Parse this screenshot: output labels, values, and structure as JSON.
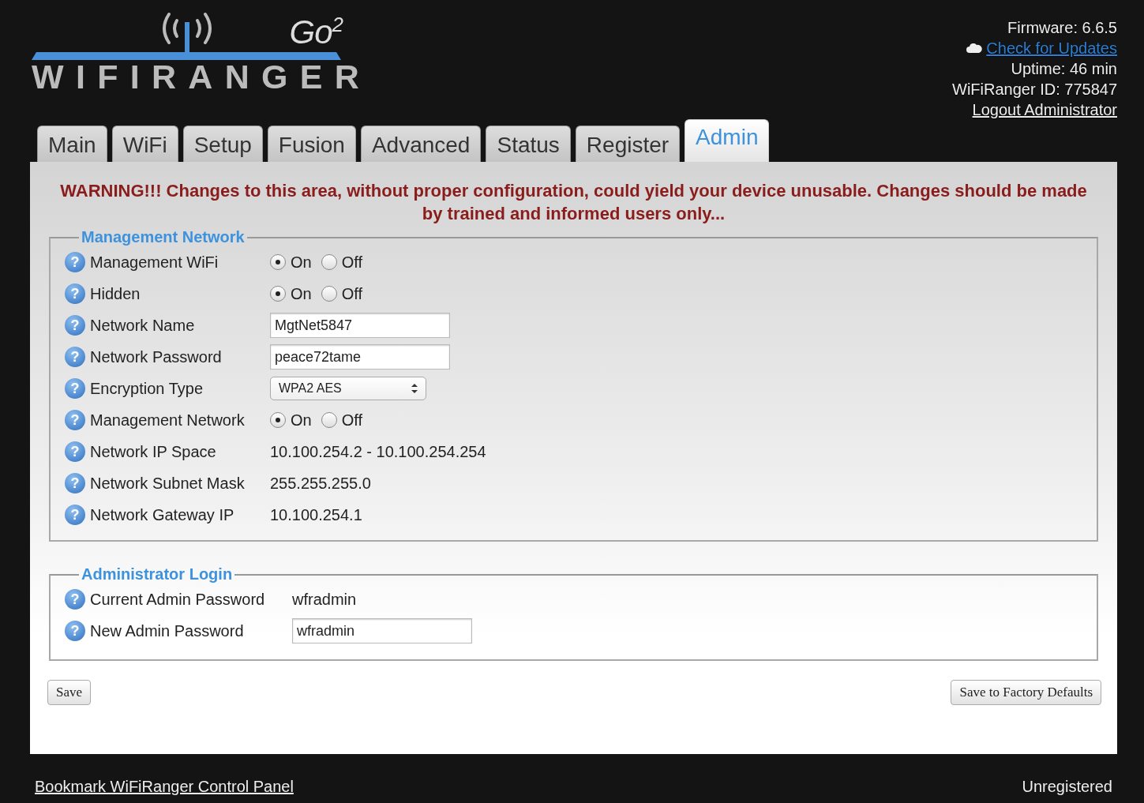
{
  "logo": {
    "edition": "Go$^{2}$",
    "wordmark": "WIFIRANGER"
  },
  "status": [
    {
      "kind": "text",
      "text": "Firmware: 6.6.5"
    },
    {
      "kind": "link",
      "text": "Check for Updates"
    },
    {
      "kind": "text",
      "text": "Uptime: 46 min"
    },
    {
      "kind": "text",
      "text": "WiFiRanger ID: 775847"
    },
    {
      "kind": "plainlink",
      "text": "Logout Administrator"
    }
  ],
  "tabs": [
    {
      "label": "Main",
      "selected": false
    },
    {
      "label": "WiFi",
      "selected": false
    },
    {
      "label": "Setup",
      "selected": false
    },
    {
      "label": "Fusion",
      "selected": false
    },
    {
      "label": "Advanced",
      "selected": false
    },
    {
      "label": "Status",
      "selected": false
    },
    {
      "label": "Register",
      "selected": false
    },
    {
      "label": "Admin",
      "selected": true
    }
  ],
  "warning": "WARNING!!! Changes to this area, without proper configuration, could yield your device unusable. Changes should be made by trained and informed users only...",
  "sections": [
    {
      "title": "Management Network",
      "rows": [
        {
          "kind": "radio",
          "help": "?",
          "label": "Management WiFi",
          "options": [
            {
              "label": "On",
              "selected": true
            },
            {
              "label": "Off",
              "selected": false
            }
          ]
        },
        {
          "kind": "radio",
          "help": "?",
          "label": "Hidden",
          "options": [
            {
              "label": "On",
              "selected": true
            },
            {
              "label": "Off",
              "selected": false
            }
          ]
        },
        {
          "kind": "input",
          "help": "?",
          "label": "Network Name",
          "value": "MgtNet5847"
        },
        {
          "kind": "input",
          "help": "?",
          "label": "Network Password",
          "value": "peace72tame"
        },
        {
          "kind": "select",
          "help": "?",
          "label": "Encryption Type",
          "value": "WPA2 AES"
        },
        {
          "kind": "radio",
          "help": "?",
          "label": "Management Network",
          "options": [
            {
              "label": "On",
              "selected": true
            },
            {
              "label": "Off",
              "selected": false
            }
          ]
        },
        {
          "kind": "value",
          "help": "?",
          "label": "Network IP Space",
          "value": "10.100.254.2 - 10.100.254.254"
        },
        {
          "kind": "value",
          "help": "?",
          "label": "Network Subnet Mask",
          "value": "255.255.255.0"
        },
        {
          "kind": "value",
          "help": "?",
          "label": "Network Gateway IP",
          "value": "10.100.254.1"
        }
      ]
    },
    {
      "title": "Administrator Login",
      "rows": [
        {
          "kind": "value",
          "help": "?",
          "label": "Current Admin Password",
          "value": "wfradmin"
        },
        {
          "kind": "input",
          "help": "?",
          "label": "New Admin Password",
          "value": "wfradmin"
        }
      ]
    }
  ],
  "buttons": [
    {
      "label": "Save"
    },
    {
      "label": "Save to Factory Defaults"
    }
  ],
  "footer": {
    "bookmark": "Bookmark WiFiRanger Control Panel",
    "registration": "Unregistered"
  }
}
